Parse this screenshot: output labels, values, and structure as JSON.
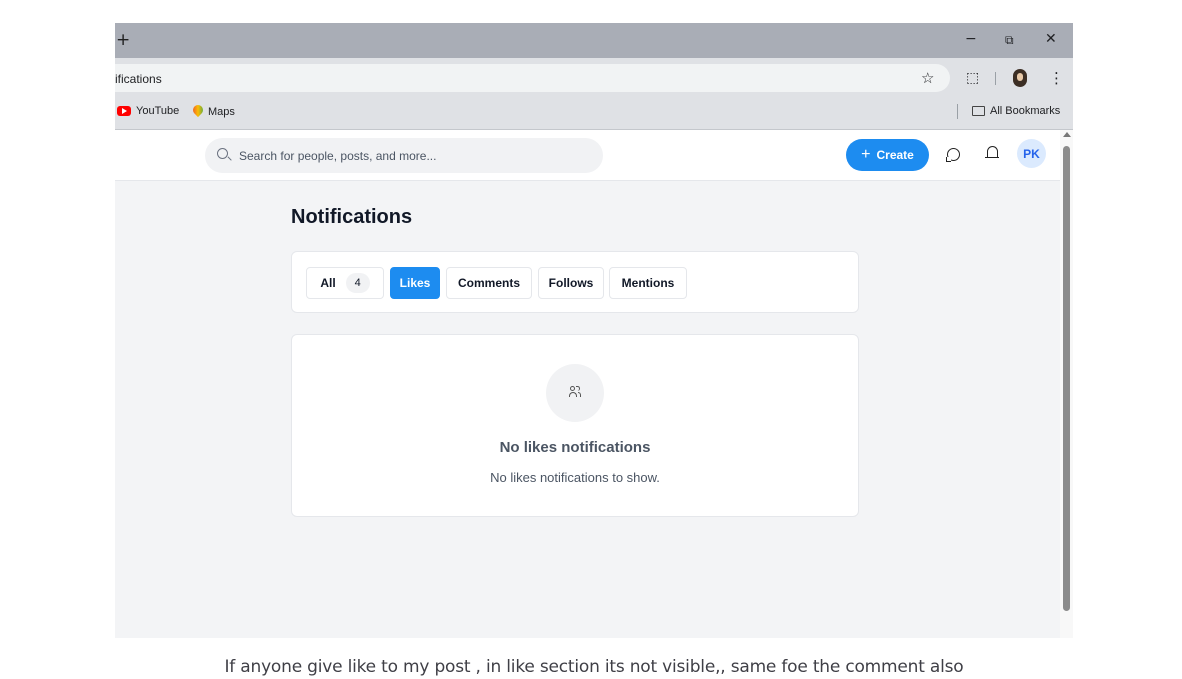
{
  "browser": {
    "new_tab_glyph": "+",
    "window_controls": {
      "minimize": "−",
      "restore": "⧉",
      "close": "✕"
    },
    "address_text": "ifications",
    "toolbar_icons": [
      "star-icon",
      "extensions-icon",
      "profile-avatar",
      "menu-icon"
    ],
    "bookmarks": [
      {
        "label": "YouTube",
        "icon": "youtube-icon"
      },
      {
        "label": "Maps",
        "icon": "maps-icon"
      }
    ],
    "all_bookmarks_label": "All Bookmarks"
  },
  "header": {
    "search_placeholder": "Search for people, posts, and more...",
    "create_label": "Create",
    "create_icon": "+",
    "icons": [
      "chat-icon",
      "bell-icon"
    ],
    "avatar_initials": "PK",
    "accent_color": "#1d8cf0"
  },
  "main": {
    "title": "Notifications",
    "tabs": [
      {
        "label": "All",
        "count": "4",
        "active": false
      },
      {
        "label": "Likes",
        "active": true
      },
      {
        "label": "Comments",
        "active": false
      },
      {
        "label": "Follows",
        "active": false
      },
      {
        "label": "Mentions",
        "active": false
      }
    ],
    "empty_state": {
      "icon": "users-icon",
      "title": "No likes notifications",
      "message": "No likes notifications to show."
    }
  },
  "caption": "If anyone give like to my post , in like section its not visible,, same foe the comment also"
}
